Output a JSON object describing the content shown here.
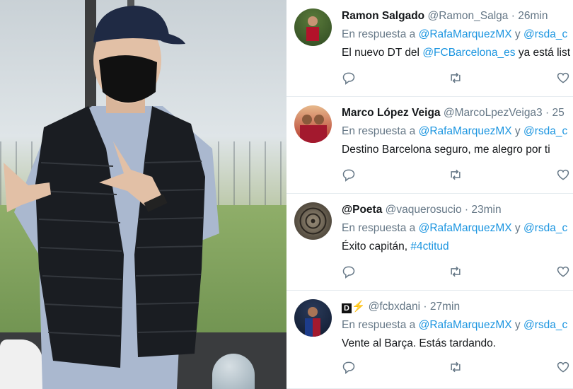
{
  "photo": {
    "description_icon": "person-photo"
  },
  "tweets": [
    {
      "name": "Ramon Salgado",
      "handle": "@Ramon_Salga",
      "dot": "·",
      "time": "26min",
      "reply_prefix": "En respuesta a",
      "reply_mention1": "@RafaMarquezMX",
      "reply_and": "y",
      "reply_mention2": "@rsda_c",
      "text_before": "El nuevo DT del",
      "text_mention": "@FCBarcelona_es",
      "text_after": "ya está list"
    },
    {
      "name": "Marco López Veiga",
      "handle": "@MarcoLpezVeiga3",
      "dot": "·",
      "time": "25",
      "reply_prefix": "En respuesta a",
      "reply_mention1": "@RafaMarquezMX",
      "reply_and": "y",
      "reply_mention2": "@rsda_c",
      "text": "Destino Barcelona seguro, me alegro por ti"
    },
    {
      "name": "@Poeta",
      "handle": "@vaquerosucio",
      "dot": "·",
      "time": "23min",
      "reply_prefix": "En respuesta a",
      "reply_mention1": "@RafaMarquezMX",
      "reply_and": "y",
      "reply_mention2": "@rsda_c",
      "text_before": "Éxito capitán,",
      "text_hashtag": "#4ctitud"
    },
    {
      "name_badge": "D",
      "name_bolt": "⚡",
      "handle": "@fcbxdani",
      "dot": "·",
      "time": "27min",
      "reply_prefix": "En respuesta a",
      "reply_mention1": "@RafaMarquezMX",
      "reply_and": "y",
      "reply_mention2": "@rsda_c",
      "text": "Vente al Barça. Estás tardando."
    }
  ],
  "colors": {
    "link": "#1b95e0",
    "secondary": "#657786",
    "primary": "#14171a",
    "divider": "#e6ecf0"
  },
  "icons": [
    "reply-icon",
    "retweet-icon",
    "like-icon"
  ]
}
